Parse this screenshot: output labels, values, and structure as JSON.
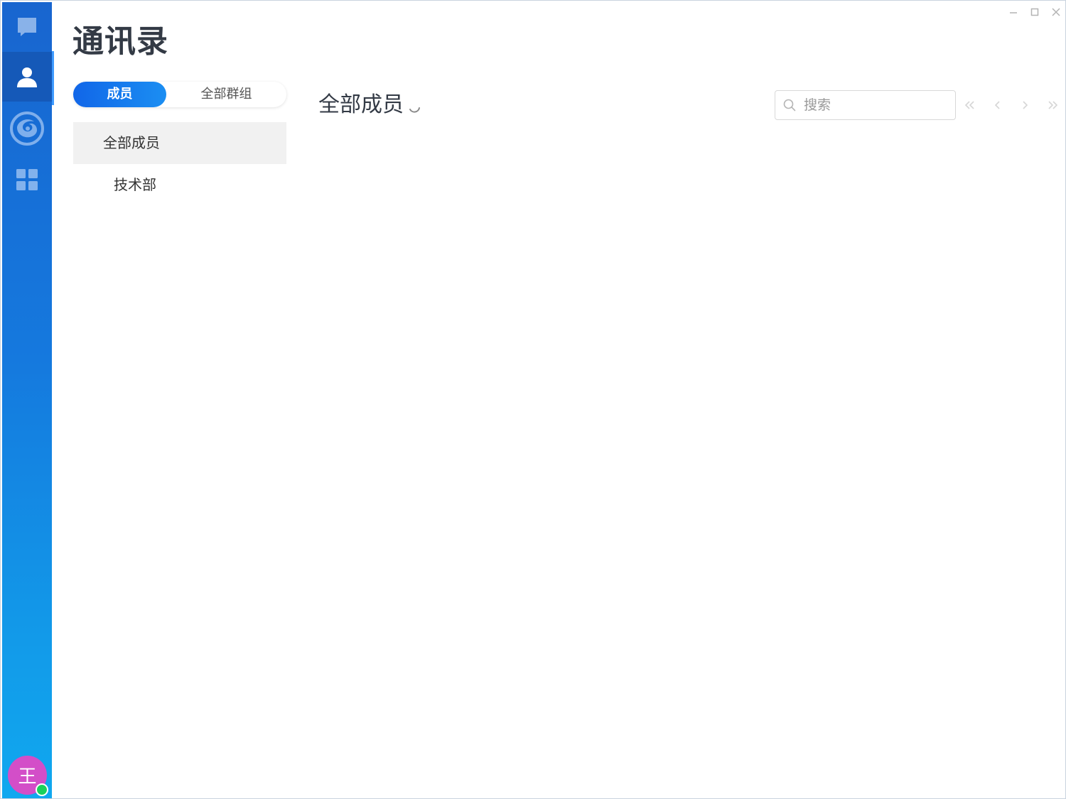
{
  "app": {
    "title": "通讯录"
  },
  "dock": {
    "items": [
      {
        "icon": "chat-icon",
        "active": false
      },
      {
        "icon": "contacts-icon",
        "active": true
      },
      {
        "icon": "swirl-app-icon",
        "active": false
      },
      {
        "icon": "apps-grid-icon",
        "active": false
      }
    ],
    "user_avatar_text": "王",
    "avatar_color": "#d34ec8",
    "presence_color": "#1ad15b"
  },
  "tabs": {
    "members_label": "成员",
    "groups_label": "全部群组",
    "active": "成员"
  },
  "departments": {
    "items": [
      {
        "label": "全部成员",
        "selected": true
      },
      {
        "label": "技术部",
        "selected": false
      }
    ]
  },
  "content": {
    "title": "全部成员",
    "loading": true
  },
  "search": {
    "placeholder": "搜索",
    "value": ""
  },
  "pager": {
    "icons": [
      "double-chevron-left-icon",
      "chevron-left-icon",
      "chevron-right-icon",
      "double-chevron-right-icon"
    ]
  },
  "colors": {
    "accent": "#1166e8",
    "dock_top": "#1865cf",
    "dock_bottom": "#10a8ef"
  }
}
